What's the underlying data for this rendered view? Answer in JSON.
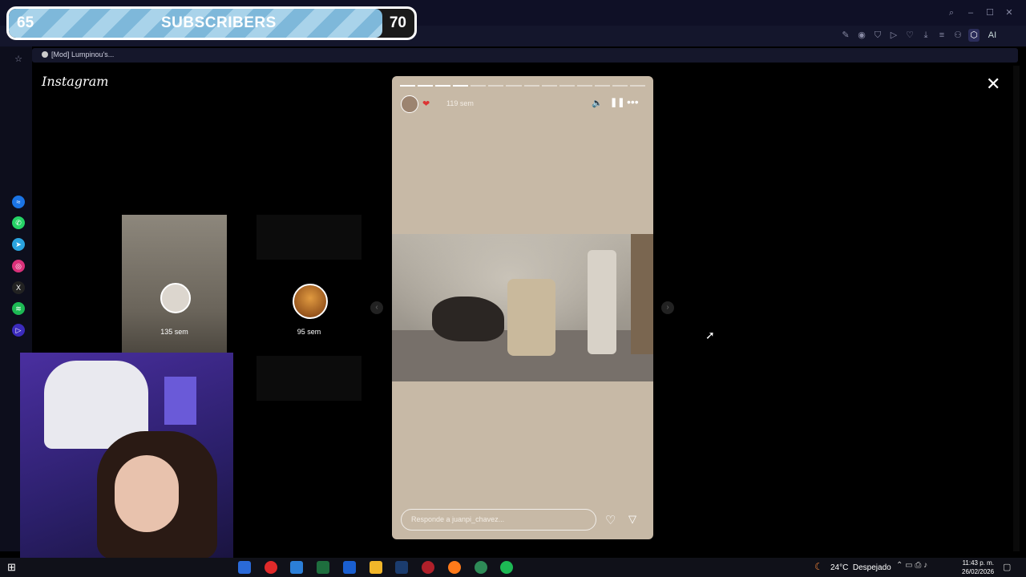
{
  "subscriber_goal": {
    "current": "65",
    "label": "SUBSCRIBERS",
    "target": "70",
    "progress": 0.92
  },
  "browser": {
    "tab_title": "[Mod] Lumpinou's...",
    "window_controls": [
      "search-icon",
      "minimize-icon",
      "maximize-icon",
      "close-icon"
    ]
  },
  "instagram": {
    "logo": "Instagram"
  },
  "story": {
    "time_ago": "119 sem",
    "reply_placeholder": "Responde a juanpi_chavez...",
    "progress_segments_total": 14,
    "progress_segments_done": 4
  },
  "thumbnails": [
    {
      "time_ago": "135 sem"
    },
    {
      "time_ago": "95 sem"
    }
  ],
  "taskbar": {
    "weather": "24°C  Despejado",
    "time": "11:43 p. m.",
    "date": "26/02/2026"
  },
  "colors": {
    "goal_fill": "#7eb8da",
    "story_bg": "#c7b9a6",
    "chrome": "#0f1026",
    "webcam_bg": "#3a2b8a"
  }
}
